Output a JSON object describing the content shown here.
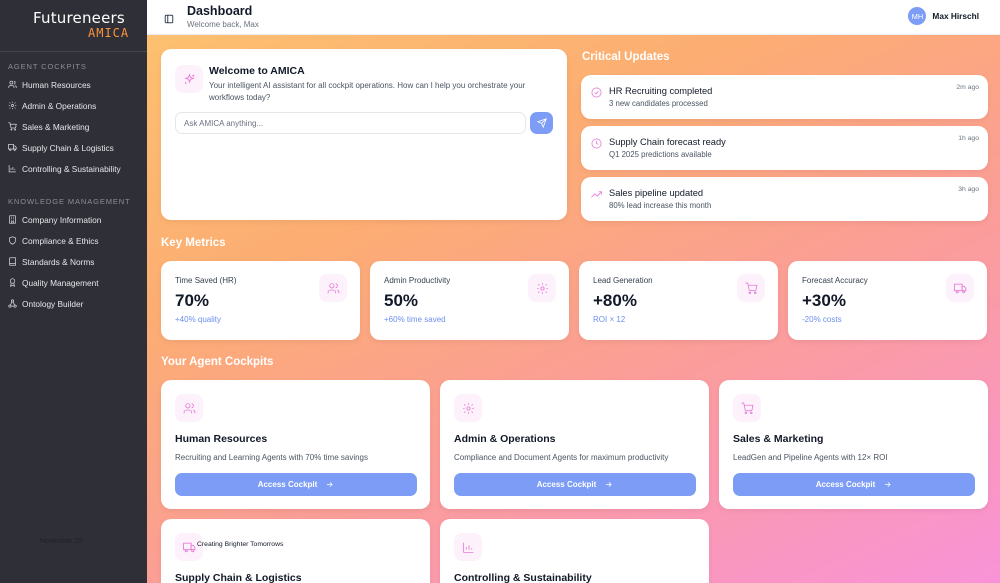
{
  "brand": {
    "name": "Futureneers",
    "product": "AMICA"
  },
  "sidebar": {
    "sections": [
      {
        "title": "AGENT COCKPITS",
        "items": [
          {
            "label": "Human Resources",
            "icon": "users-icon"
          },
          {
            "label": "Admin & Operations",
            "icon": "gear-icon"
          },
          {
            "label": "Sales & Marketing",
            "icon": "cart-icon"
          },
          {
            "label": "Supply Chain & Logistics",
            "icon": "truck-icon"
          },
          {
            "label": "Controlling & Sustainability",
            "icon": "chart-icon"
          }
        ]
      },
      {
        "title": "KNOWLEDGE MANAGEMENT",
        "items": [
          {
            "label": "Company Information",
            "icon": "building-icon"
          },
          {
            "label": "Compliance & Ethics",
            "icon": "shield-icon"
          },
          {
            "label": "Standards & Norms",
            "icon": "book-icon"
          },
          {
            "label": "Quality Management",
            "icon": "award-icon"
          },
          {
            "label": "Ontology Builder",
            "icon": "network-icon"
          }
        ]
      }
    ],
    "footer_text": "November 25"
  },
  "header": {
    "title": "Dashboard",
    "subtitle": "Welcome back, Max",
    "user": {
      "initials": "MH",
      "name": "Max Hirschl"
    }
  },
  "welcome": {
    "title": "Welcome to AMICA",
    "text": "Your intelligent AI assistant for all cockpit operations. How can I help you orchestrate your workflows today?",
    "input_placeholder": "Ask AMICA anything..."
  },
  "critical_updates": {
    "heading": "Critical Updates",
    "items": [
      {
        "title": "HR Recruiting completed",
        "subtitle": "3 new candidates processed",
        "time": "2m ago",
        "icon": "check-circle-icon"
      },
      {
        "title": "Supply Chain forecast ready",
        "subtitle": "Q1 2025 predictions available",
        "time": "1h ago",
        "icon": "clock-icon"
      },
      {
        "title": "Sales pipeline updated",
        "subtitle": "80% lead increase this month",
        "time": "3h ago",
        "icon": "trending-up-icon"
      }
    ]
  },
  "metrics": {
    "heading": "Key Metrics",
    "items": [
      {
        "label": "Time Saved (HR)",
        "value": "70%",
        "sub": "+40% quality",
        "icon": "users-icon"
      },
      {
        "label": "Admin Productivity",
        "value": "50%",
        "sub": "+60% time saved",
        "icon": "gear-icon"
      },
      {
        "label": "Lead Generation",
        "value": "+80%",
        "sub": "ROI × 12",
        "icon": "cart-icon"
      },
      {
        "label": "Forecast Accuracy",
        "value": "+30%",
        "sub": "-20% costs",
        "icon": "truck-icon"
      }
    ]
  },
  "cockpits": {
    "heading": "Your Agent Cockpits",
    "button_label": "Access Cockpit",
    "items": [
      {
        "title": "Human Resources",
        "desc": "Recruiting and Learning Agents with 70% time savings",
        "icon": "users-icon"
      },
      {
        "title": "Admin & Operations",
        "desc": "Compliance and Document Agents for maximum productivity",
        "icon": "gear-icon"
      },
      {
        "title": "Sales & Marketing",
        "desc": "LeadGen and Pipeline Agents with 12× ROI",
        "icon": "cart-icon"
      },
      {
        "title": "Supply Chain & Logistics",
        "desc": "",
        "icon": "truck-icon"
      },
      {
        "title": "Controlling & Sustainability",
        "desc": "",
        "icon": "chart-icon"
      }
    ],
    "tagline": "Creating Brighter Tomorrows"
  },
  "colors": {
    "accent": "#7c9cf5",
    "icon_pink": "#e879d8",
    "sidebar_bg": "#2f3037",
    "logo_orange": "#fb923c"
  }
}
